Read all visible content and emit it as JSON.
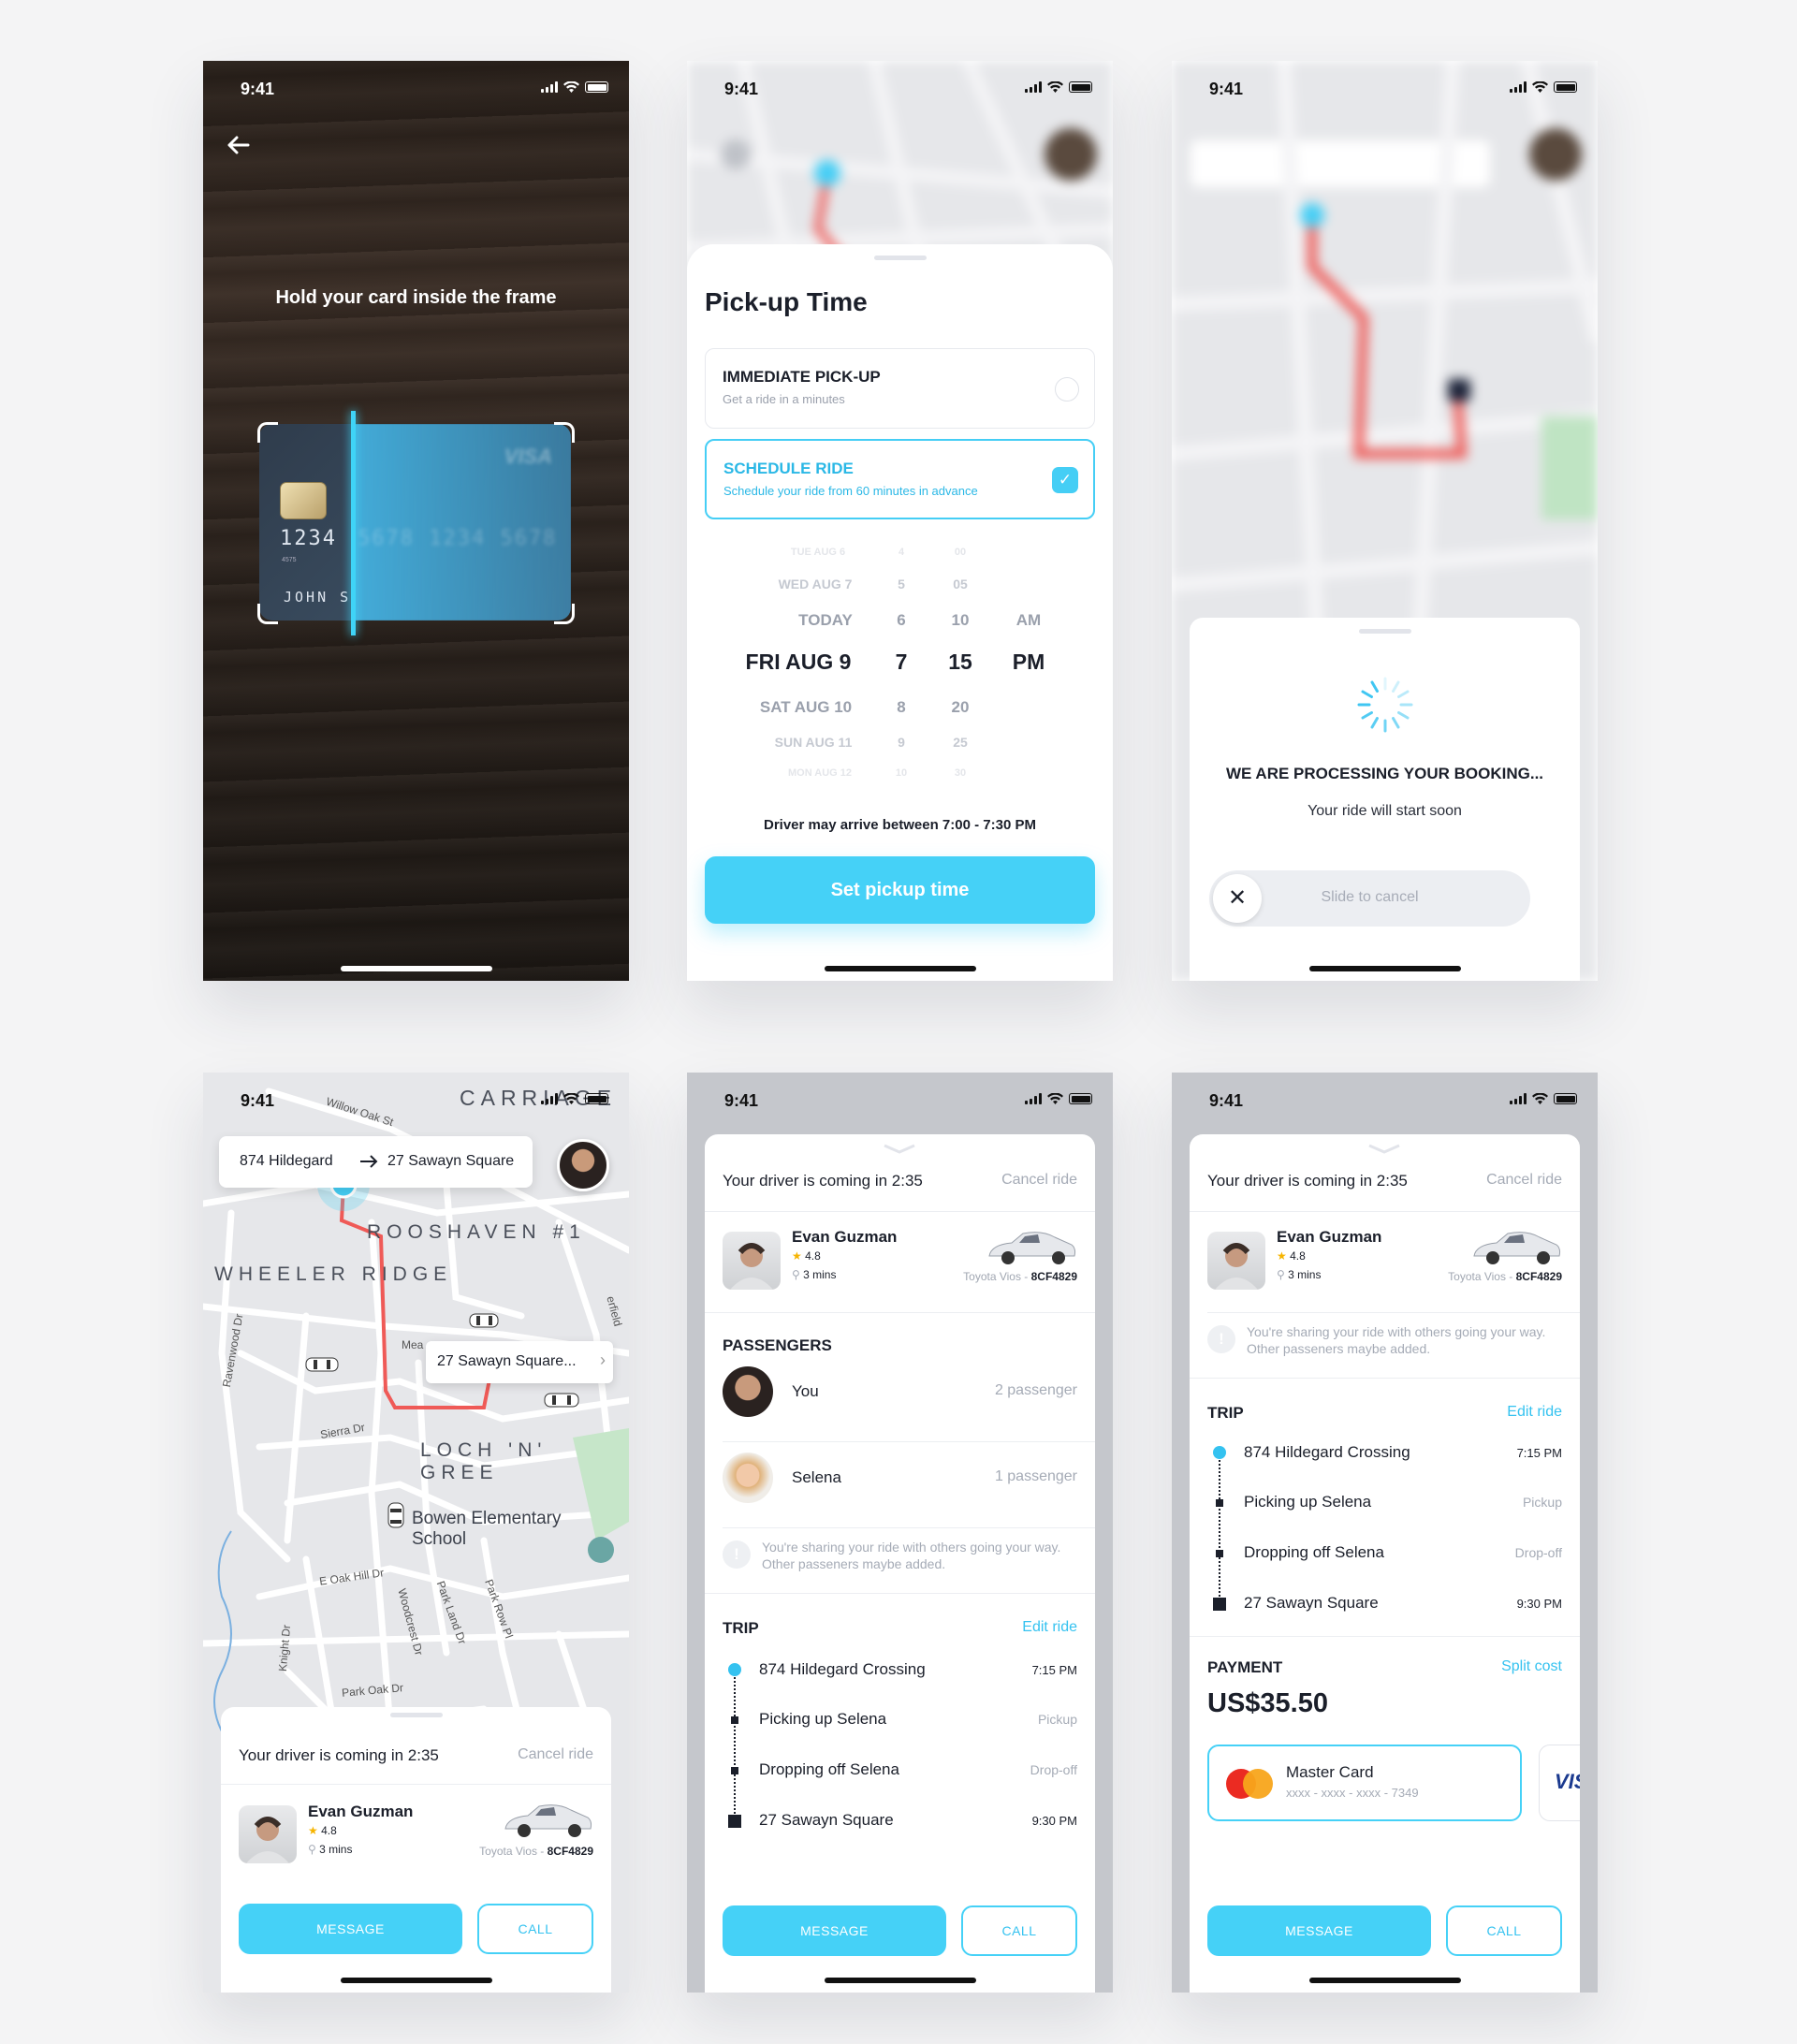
{
  "status": {
    "time": "9:41"
  },
  "scan": {
    "title": "Hold your card inside the frame",
    "card_number_visible": "1234",
    "card_small": "4575",
    "card_name_visible": "JOHN S",
    "card_brand": "VISA"
  },
  "pickup": {
    "title": "Pick-up Time",
    "immediate": {
      "title": "IMMEDIATE PICK-UP",
      "subtitle": "Get a ride in a minutes"
    },
    "schedule": {
      "title": "SCHEDULE RIDE",
      "subtitle": "Schedule your ride from 60 minutes in advance"
    },
    "days": [
      "TUE AUG 6",
      "WED AUG 7",
      "TODAY",
      "FRI AUG 9",
      "SAT AUG 10",
      "SUN AUG 11",
      "MON AUG 12"
    ],
    "hours": [
      "4",
      "5",
      "6",
      "7",
      "8",
      "9",
      "10"
    ],
    "minutes": [
      "00",
      "05",
      "10",
      "15",
      "20",
      "25",
      "30"
    ],
    "ampm": [
      "AM",
      "PM"
    ],
    "arrive_note": "Driver may arrive between 7:00 - 7:30 PM",
    "cta": "Set pickup time"
  },
  "processing": {
    "title": "WE ARE PROCESSING YOUR BOOKING...",
    "subtitle": "Your ride will start soon",
    "slide": "Slide to cancel"
  },
  "map": {
    "from": "874 Hildegard",
    "to": "27 Sawayn Square",
    "tooltip": "27 Sawayn Square...",
    "labels": [
      "CARRIAGE",
      "ROOSHAVEN #1",
      "WHEELER RIDGE",
      "LOCH 'N' GREE",
      "Bowen Elementary School",
      "Willow Oak St",
      "Ravenwood Dr",
      "Sierra Dr",
      "E Oak Hill Dr",
      "Woodcrest Dr",
      "Park Land Dr",
      "Park Row Pl",
      "Knight Dr",
      "Park Oak Dr",
      "Mea",
      "erfield"
    ]
  },
  "ride": {
    "coming": "Your driver is coming in 2:35",
    "cancel": "Cancel ride",
    "driver": {
      "name": "Evan Guzman",
      "rating": "4.8",
      "mins": "3 mins",
      "car": "Toyota Vios - ",
      "plate": "8CF4829"
    },
    "passengers_title": "PASSENGERS",
    "passengers": [
      {
        "name": "You",
        "count": "2 passenger"
      },
      {
        "name": "Selena",
        "count": "1 passenger"
      }
    ],
    "note": "You're sharing your ride with others going your way. Other passeners maybe added.",
    "trip_title": "TRIP",
    "edit": "Edit ride",
    "trip": [
      {
        "name": "874 Hildegard Crossing",
        "time": "7:15 PM"
      },
      {
        "name": "Picking up Selena",
        "time": "Pickup"
      },
      {
        "name": "Dropping off Selena",
        "time": "Drop-off"
      },
      {
        "name": "27 Sawayn Square",
        "time": "9:30 PM"
      }
    ],
    "payment_title": "PAYMENT",
    "split": "Split cost",
    "amount": "US$35.50",
    "card_name": "Master Card",
    "card_num": "xxxx - xxxx - xxxx - 7349",
    "visa": "VIS",
    "message": "MESSAGE",
    "call": "CALL"
  },
  "colors": {
    "accent": "#45d1f7",
    "route": "#ef5a57"
  }
}
